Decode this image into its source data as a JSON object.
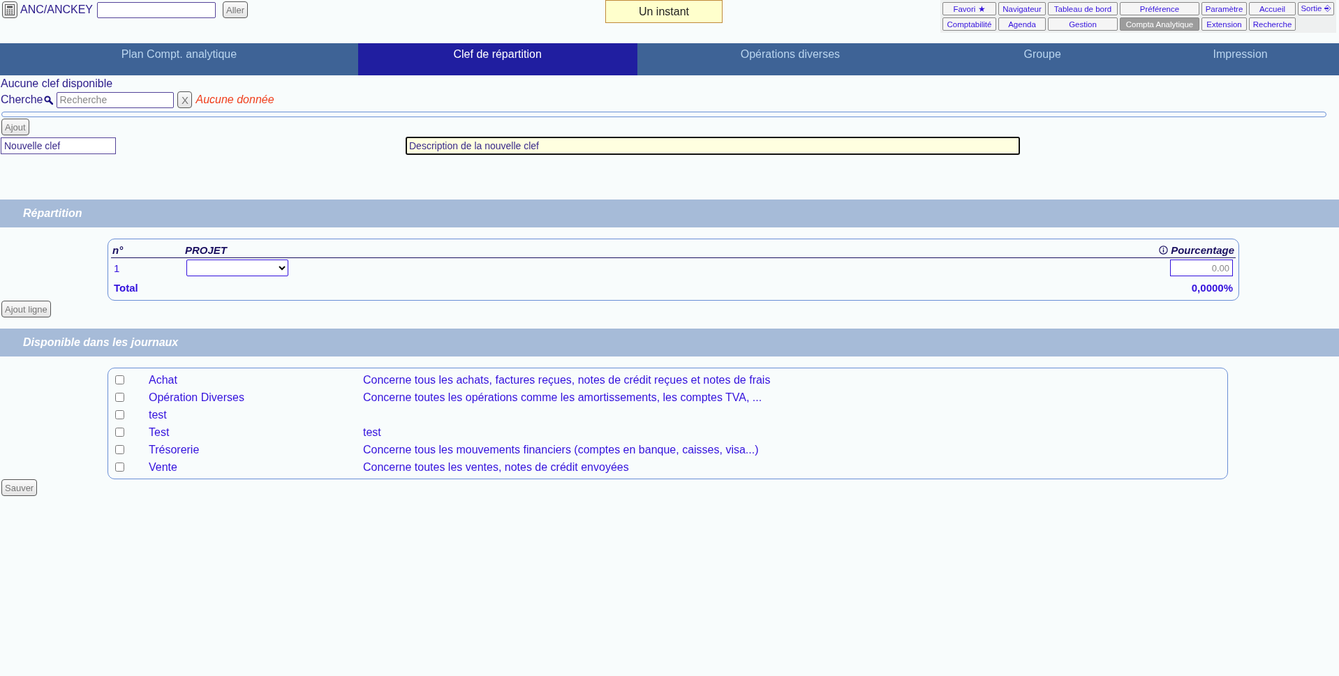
{
  "header": {
    "path_label": "ANC/ANCKEY",
    "go_button": "Aller",
    "status": "Un instant"
  },
  "nav_buttons": [
    {
      "label": "Favori ★",
      "selected": false
    },
    {
      "label": "Navigateur",
      "selected": false
    },
    {
      "label": "Tableau de bord",
      "selected": false
    },
    {
      "label": "Préférence",
      "selected": false
    },
    {
      "label": "Paramètre",
      "selected": false
    },
    {
      "label": "Accueil",
      "selected": false
    },
    {
      "label": "Sortie ⎆",
      "selected": false
    },
    {
      "label": "Comptabilité",
      "selected": false
    },
    {
      "label": "Agenda",
      "selected": false
    },
    {
      "label": "Gestion",
      "selected": false
    },
    {
      "label": "Compta Analytique",
      "selected": true
    },
    {
      "label": "Extension",
      "selected": false
    },
    {
      "label": "Recherche",
      "selected": false
    }
  ],
  "tabs": [
    {
      "label": "Plan Compt. analytique",
      "selected": false
    },
    {
      "label": "Clef de répartition",
      "selected": true
    },
    {
      "label": "Opérations diverses",
      "selected": false
    },
    {
      "label": "Groupe",
      "selected": false
    },
    {
      "label": "Impression",
      "selected": false
    }
  ],
  "message": "Aucune clef disponible",
  "search": {
    "label": "Cherche",
    "placeholder": "Recherche",
    "clear_button": "X",
    "status": "Aucune donnée"
  },
  "add_button": "Ajout",
  "new_key": {
    "name": {
      "value": "Nouvelle clef"
    },
    "description": {
      "value": "Description de la nouvelle clef"
    }
  },
  "repartition": {
    "title": "Répartition",
    "columns": [
      "n°",
      "PROJET",
      "Pourcentage"
    ],
    "rows": [
      {
        "number": "1",
        "percentage": {
          "placeholder": "0.00"
        }
      }
    ],
    "total": {
      "label": "Total",
      "value": "0,0000%"
    },
    "add_line_button": "Ajout ligne"
  },
  "journals": {
    "title": "Disponible dans les journaux",
    "rows": [
      {
        "name": "Achat",
        "description": "Concerne tous les achats, factures reçues, notes de crédit reçues et notes de frais",
        "checked": false
      },
      {
        "name": "Opération Diverses",
        "description": "Concerne toutes les opérations comme les amortissements, les comptes TVA, ...",
        "checked": false
      },
      {
        "name": "test",
        "checked": false
      },
      {
        "name": "Test",
        "description": "test",
        "checked": false
      },
      {
        "name": "Trésorerie",
        "description": "Concerne tous les mouvements financiers (comptes en banque, caisses, visa...)",
        "checked": false
      },
      {
        "name": "Vente",
        "description": "Concerne toutes les ventes, notes de crédit envoyées",
        "checked": false
      }
    ],
    "save_button": "Sauver"
  }
}
